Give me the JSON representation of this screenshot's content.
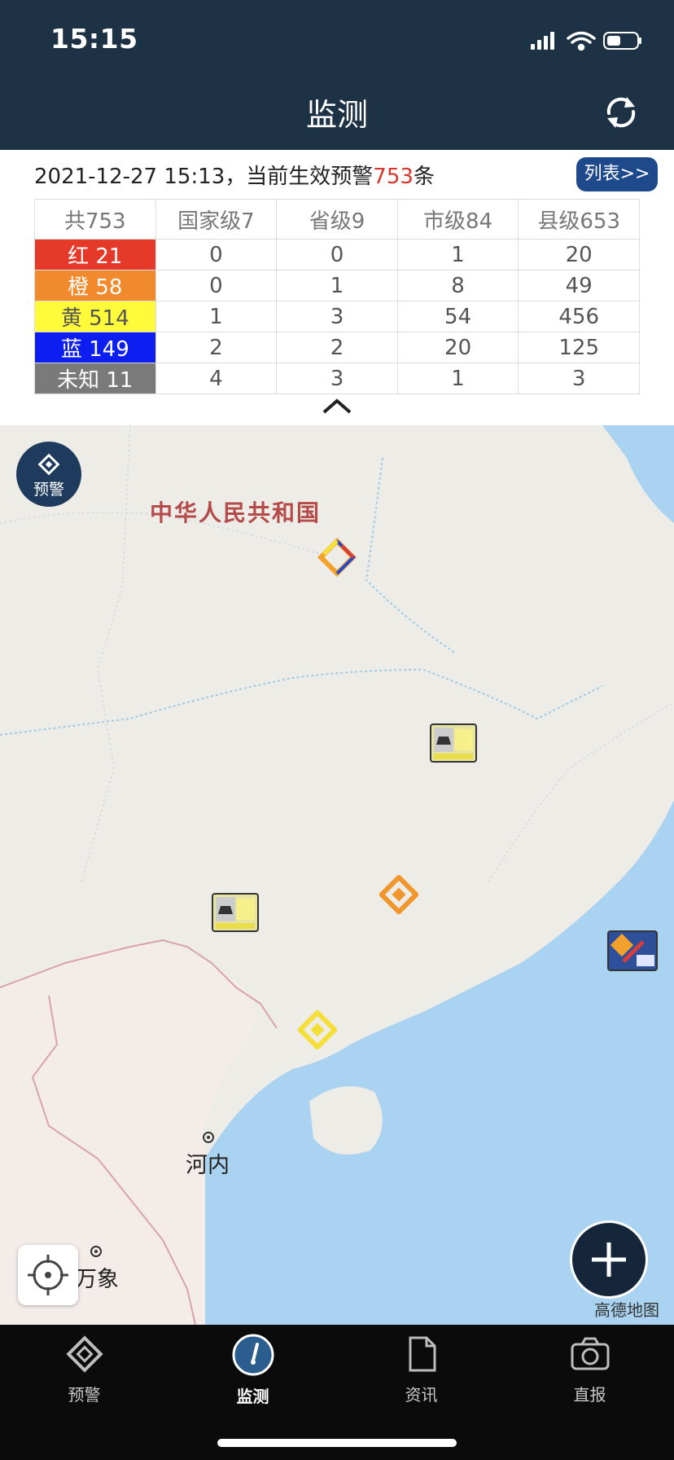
{
  "status_bar": {
    "time": "15:15"
  },
  "header": {
    "title": "监测",
    "refresh_icon": "refresh-icon"
  },
  "summary": {
    "datetime": "2021-12-27 15:13，当前生效预警",
    "count": "753",
    "suffix": "条",
    "list_button": "列表>>"
  },
  "table": {
    "headers": [
      "共753",
      "国家级7",
      "省级9",
      "市级84",
      "县级653"
    ],
    "rows": [
      {
        "label": "红 21",
        "color": "#e53a2a",
        "values": [
          "0",
          "0",
          "1",
          "20"
        ]
      },
      {
        "label": "橙 58",
        "color": "#f08a2c",
        "values": [
          "0",
          "1",
          "8",
          "49"
        ]
      },
      {
        "label": "黄 514",
        "color": "#fffb3a",
        "values": [
          "1",
          "3",
          "54",
          "456"
        ]
      },
      {
        "label": "蓝 149",
        "color": "#0d1ff0",
        "values": [
          "2",
          "2",
          "20",
          "125"
        ]
      },
      {
        "label": "未知 11",
        "color": "#7a7a7a",
        "values": [
          "4",
          "3",
          "1",
          "3"
        ]
      }
    ]
  },
  "map": {
    "warning_fab": "预警",
    "labels": {
      "china": "中华人民共和国",
      "hanoi": "河内",
      "vientiane": "万象"
    },
    "watermark": "高德地图"
  },
  "tabs": [
    {
      "label": "预警",
      "icon": "warning-tab-icon"
    },
    {
      "label": "监测",
      "icon": "gauge-tab-icon"
    },
    {
      "label": "资讯",
      "icon": "document-tab-icon"
    },
    {
      "label": "直报",
      "icon": "camera-tab-icon"
    }
  ]
}
